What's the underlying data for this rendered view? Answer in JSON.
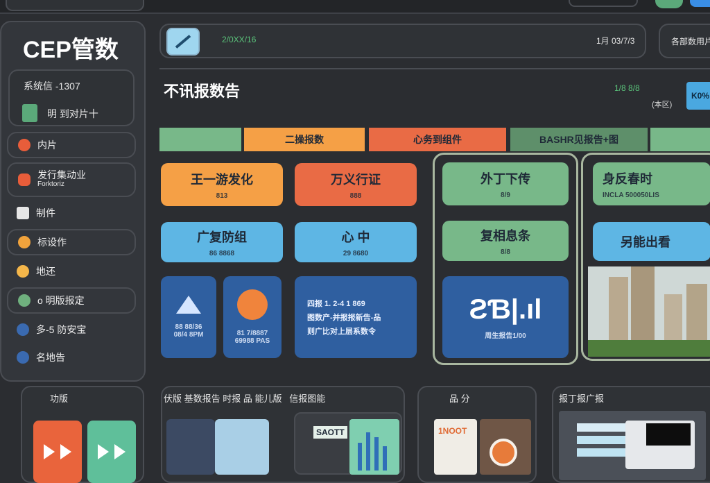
{
  "app": {
    "logo": "CEP管数"
  },
  "sidebar": {
    "header_label": "系统信 -1307",
    "header_sub": "明 到对片十",
    "items": [
      {
        "label": "内片",
        "color": "#e85d3a"
      },
      {
        "label": "发行集动业",
        "sub": "Forktoriz",
        "color": "#e85d3a"
      },
      {
        "label": "制件",
        "color": "#e6e6e6"
      },
      {
        "label": "标设作",
        "color": "#f1a33c"
      },
      {
        "label": "地还",
        "color": "#f4b64a"
      },
      {
        "label": "o 明版报定",
        "color": "#6fb07e"
      },
      {
        "label": "多-5 防安宝",
        "color": "#3a6ab0"
      },
      {
        "label": "名地告",
        "color": "#3a6ab0"
      }
    ]
  },
  "header": {
    "mid_text": "2/0XX/16",
    "right_text": "1月 03/7/3",
    "button": "各部数用片"
  },
  "page": {
    "title": "不讯报数告",
    "stat_value": "1/8 8/8",
    "stat_label": "(本区)",
    "badge": "K0%"
  },
  "category_bars": [
    {
      "label": "",
      "color": "#78b889"
    },
    {
      "label": "二操报数",
      "color": "#f5a046"
    },
    {
      "label": "心务到组件",
      "color": "#e96b45"
    },
    {
      "label": "BASHR见报告+图",
      "color": "#5e8f6a"
    },
    {
      "label": "",
      "color": "#78b889"
    }
  ],
  "tiles": {
    "t1": {
      "title": "王一游发化",
      "sub": "813"
    },
    "t2": {
      "title": "万义行证",
      "sub": "888"
    },
    "t3": {
      "title": "广复防组",
      "sub": "86 8868"
    },
    "t4": {
      "title": "心 中",
      "sub": "29 8680"
    },
    "t5_sub": "88 88/36\n08/4 8PM",
    "t6_sub": "81 7/8887\n69988 PAS",
    "t7_lines": [
      "四报  1. 2-4 1 869",
      "图数产-并报报新告-品",
      "则广比对上层系数令"
    ],
    "g1": {
      "title": "外丁下传",
      "sub": "8/9"
    },
    "g2": {
      "title": "复相息条",
      "sub": "8/8"
    },
    "logo_tile_text": "ƧƁ|.ıl",
    "logo_tile_sub": "周生报告1/00",
    "r1": {
      "title": "身反春时",
      "sub": "INCLA 500050LIS"
    },
    "r2": {
      "title": "另能出看"
    }
  },
  "bottom": {
    "p1": "功版",
    "p2": "伏版 基数报告 时报 品 能儿版   信报图能",
    "p3": "品 分",
    "p4": "报丁报广报",
    "p3_card": "1NOOT",
    "p2_card": "SAOTT"
  },
  "colors": {
    "bg": "#2b2d31",
    "accent_blue": "#5eb6e4"
  }
}
